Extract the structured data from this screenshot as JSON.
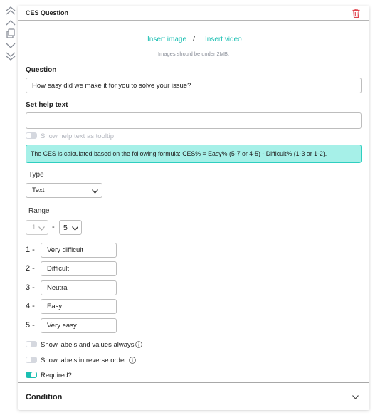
{
  "sidebar": {
    "icons": [
      "chevrons-up-icon",
      "chevron-up-icon",
      "copy-icon",
      "chevron-down-icon",
      "chevrons-down-icon"
    ]
  },
  "header": {
    "title": "CES Question",
    "delete_icon": "trash-icon"
  },
  "media": {
    "insert_image": "Insert image",
    "separator": "/",
    "insert_video": "Insert video",
    "hint": "Images should be under 2MB."
  },
  "question": {
    "label": "Question",
    "value": "How easy did we make it for you to solve your issue?"
  },
  "help_text": {
    "label": "Set help text",
    "value": "",
    "tooltip_toggle": "Show help text as tooltip",
    "tooltip_on": false
  },
  "info_box": {
    "text": "The CES is calculated based on the following formula: CES% = Easy% (5-7 or 4-5) - Difficult% (1-3 or 1-2).",
    "color": "#a6f0e8"
  },
  "type": {
    "label": "Type",
    "value": "Text"
  },
  "range": {
    "label": "Range",
    "from": "1",
    "dash": "-",
    "to": "5"
  },
  "scale": [
    {
      "n": "1 -",
      "label": "Very difficult"
    },
    {
      "n": "2 -",
      "label": "Difficult"
    },
    {
      "n": "3 -",
      "label": "Neutral"
    },
    {
      "n": "4 -",
      "label": "Easy"
    },
    {
      "n": "5 -",
      "label": "Very easy"
    }
  ],
  "options": [
    {
      "label": "Show labels and values always",
      "on": false,
      "info": true
    },
    {
      "label": "Show labels in reverse order",
      "on": false,
      "info": true
    },
    {
      "label": "Required?",
      "on": true,
      "info": false
    }
  ],
  "condition": {
    "label": "Condition"
  },
  "colors": {
    "accent": "#1bbfb2",
    "danger": "#e0454f"
  }
}
